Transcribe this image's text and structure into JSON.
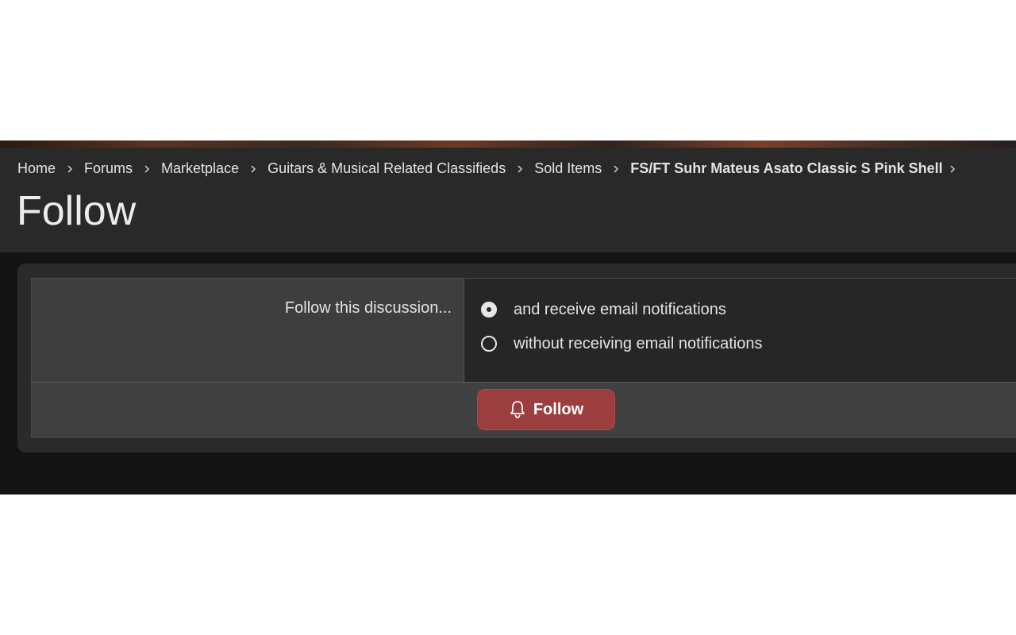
{
  "breadcrumb": {
    "items": [
      {
        "label": "Home"
      },
      {
        "label": "Forums"
      },
      {
        "label": "Marketplace"
      },
      {
        "label": "Guitars & Musical Related Classifieds"
      },
      {
        "label": "Sold Items"
      },
      {
        "label": "FS/FT Suhr Mateus Asato Classic S Pink Shell"
      }
    ]
  },
  "page": {
    "title": "Follow"
  },
  "form": {
    "label": "Follow this discussion...",
    "options": [
      {
        "label": "and receive email notifications",
        "selected": true
      },
      {
        "label": "without receiving email notifications",
        "selected": false
      }
    ],
    "submit_label": "Follow"
  },
  "colors": {
    "header_bg": "#292929",
    "page_bg": "#141414",
    "button_bg": "#9c3e3e"
  },
  "icons": [
    "chevron-right-icon",
    "bell-icon",
    "radio-icon"
  ]
}
